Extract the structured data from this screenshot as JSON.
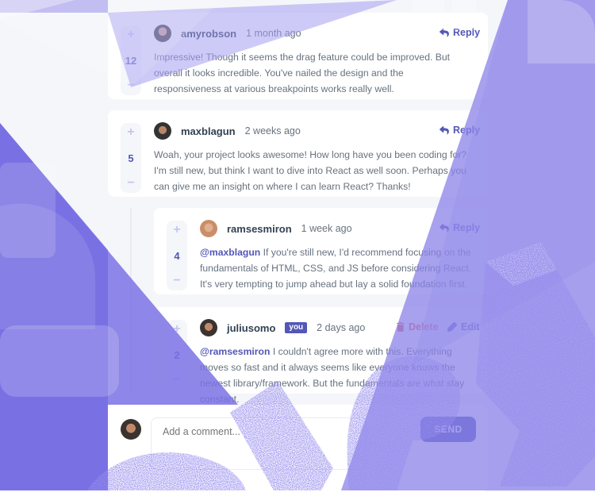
{
  "comments": [
    {
      "user": "amyrobson",
      "time": "1 month ago",
      "score": "12",
      "reply_label": "Reply",
      "text": "Impressive! Though it seems the drag feature could be improved. But overall it looks incredible. You've nailed the design and the responsiveness at various breakpoints works really well."
    },
    {
      "user": "maxblagun",
      "time": "2 weeks ago",
      "score": "5",
      "reply_label": "Reply",
      "text": "Woah, your project looks awesome! How long have you been coding for? I'm still new, but think I want to dive into React as well soon. Perhaps you can give me an insight on where I can learn React? Thanks!"
    }
  ],
  "replies": [
    {
      "user": "ramsesmiron",
      "time": "1 week ago",
      "score": "4",
      "reply_label": "Reply",
      "mention": "@maxblagun",
      "text": "If you're still new, I'd recommend focusing on the fundamentals of HTML, CSS, and JS before considering React. It's very tempting to jump ahead but lay a solid foundation first."
    },
    {
      "user": "juliusomo",
      "you_badge": "you",
      "time": "2 days ago",
      "score": "2",
      "delete_label": "Delete",
      "edit_label": "Edit",
      "mention": "@ramsesmiron",
      "text": "I couldn't agree more with this. Everything moves so fast and it always seems like everyone knows the newest library/framework. But the fundamentals are what stay constant."
    }
  ],
  "vote": {
    "plus": "+",
    "minus": "−"
  },
  "composer": {
    "placeholder": "Add a comment...",
    "send_label": "SEND"
  },
  "colors": {
    "accent": "#5357b6",
    "accent_light": "#c5c6ef",
    "danger": "#ed6368",
    "overlay_purple": "#8a82e8",
    "overlay_dark": "#4a43d6"
  },
  "icons": [
    "reply-icon",
    "delete-icon",
    "edit-icon"
  ]
}
